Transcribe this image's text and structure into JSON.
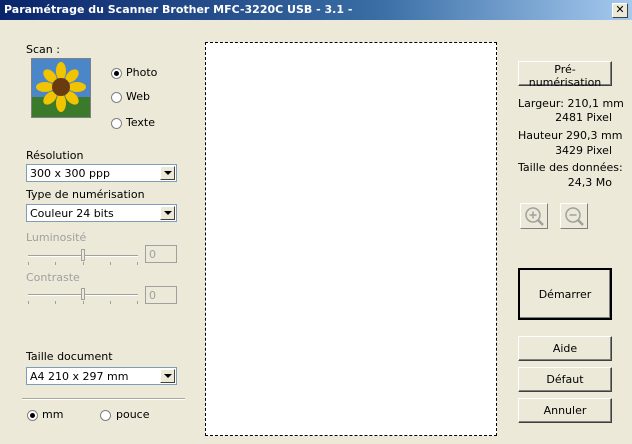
{
  "window": {
    "title": "Paramétrage du Scanner Brother MFC-3220C USB - 3.1 -",
    "close_glyph": "✕"
  },
  "scan": {
    "label": "Scan :",
    "options": [
      {
        "label": "Photo",
        "selected": true
      },
      {
        "label": "Web",
        "selected": false
      },
      {
        "label": "Texte",
        "selected": false
      }
    ]
  },
  "resolution": {
    "label": "Résolution",
    "value": "300 x 300 ppp"
  },
  "scan_type": {
    "label": "Type de numérisation",
    "value": "Couleur 24 bits"
  },
  "brightness": {
    "label": "Luminosité",
    "value": "0"
  },
  "contrast": {
    "label": "Contraste",
    "value": "0"
  },
  "document_size": {
    "label": "Taille document",
    "value": "A4 210 x 297 mm"
  },
  "units": [
    {
      "label": "mm",
      "selected": true
    },
    {
      "label": "pouce",
      "selected": false
    }
  ],
  "info": {
    "prescan_button": "Pré-numérisation",
    "width_line1": "Largeur: 210,1 mm",
    "width_line2": "2481 Pixel",
    "height_line1": "Hauteur 290,3 mm",
    "height_line2": "3429 Pixel",
    "data_size_label": "Taille des données:",
    "data_size_value": "24,3 Mo"
  },
  "buttons": {
    "start": "Démarrer",
    "help": "Aide",
    "default": "Défaut",
    "cancel": "Annuler"
  },
  "icons": {
    "zoom_in": "zoom-in-icon",
    "zoom_out": "zoom-out-icon"
  },
  "colors": {
    "titlebar_start": "#0a246a",
    "titlebar_end": "#a6caf0",
    "face": "#ece9d8"
  }
}
